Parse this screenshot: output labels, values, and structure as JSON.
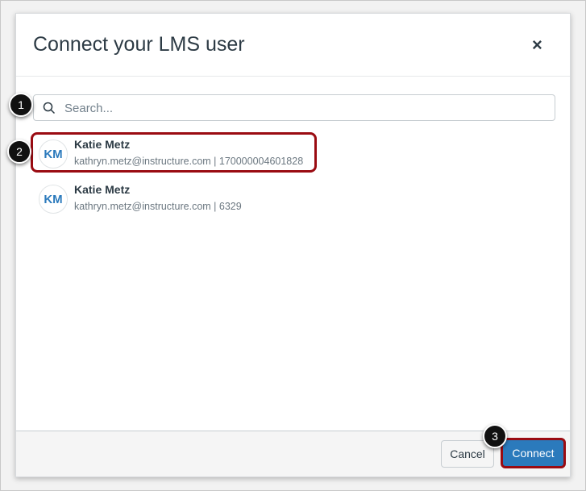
{
  "dialog": {
    "title": "Connect your LMS user",
    "close_label": "×"
  },
  "search": {
    "placeholder": "Search...",
    "value": ""
  },
  "users": [
    {
      "initials": "KM",
      "name": "Katie Metz",
      "detail": "kathryn.metz@instructure.com | 170000004601828"
    },
    {
      "initials": "KM",
      "name": "Katie Metz",
      "detail": "kathryn.metz@instructure.com | 6329"
    }
  ],
  "footer": {
    "cancel_label": "Cancel",
    "connect_label": "Connect"
  },
  "callouts": [
    "1",
    "2",
    "3"
  ]
}
